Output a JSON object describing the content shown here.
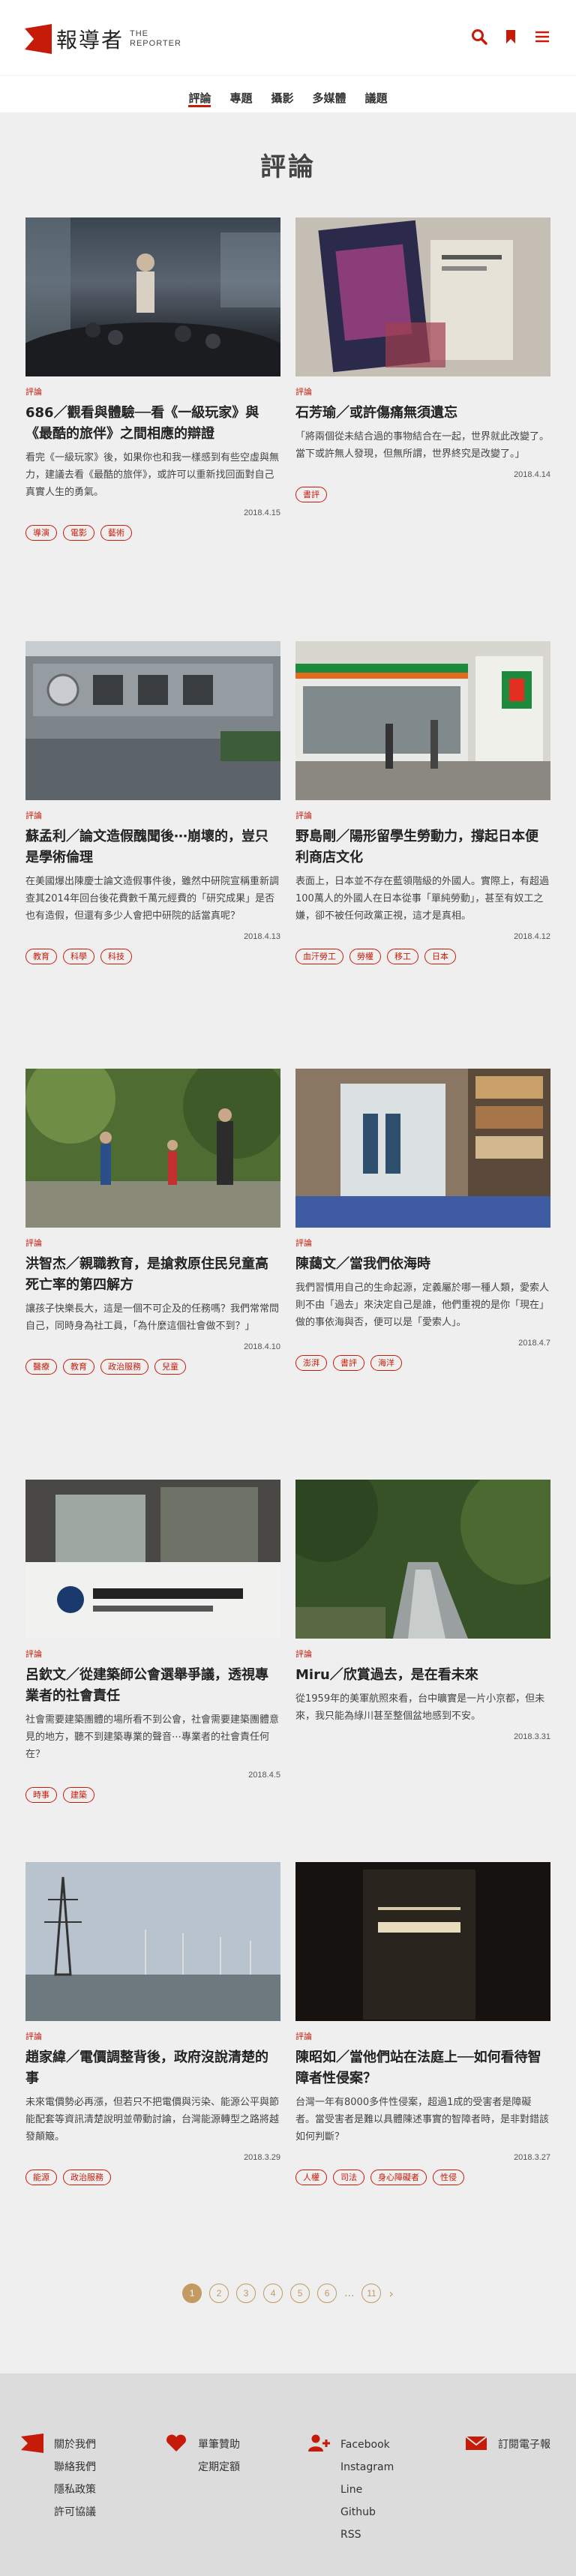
{
  "header": {
    "logo_zh": "報導者",
    "logo_en_1": "THE",
    "logo_en_2": "REPORTER"
  },
  "nav": {
    "items": [
      "評論",
      "專題",
      "攝影",
      "多媒體",
      "議題"
    ],
    "active": "評論"
  },
  "page_title": "評論",
  "cards": [
    {
      "tag": "評論",
      "title": "686／觀看與體驗──看《一級玩家》與《最酷的旅伴》之間相應的辯證",
      "excerpt": "看完《一級玩家》後，如果你也和我一樣感到有些空虛與無力，建議去看《最酷的旅伴》，或許可以重新找回面對自己真實人生的勇氣。",
      "date": "2018.4.15",
      "tags": [
        "導演",
        "電影",
        "藝術"
      ]
    },
    {
      "tag": "評論",
      "title": "石芳瑜／或許傷痛無須遺忘",
      "excerpt": "「將兩個從未結合過的事物結合在一起，世界就此改變了。當下或許無人發現，但無所謂，世界終究是改變了。」",
      "date": "2018.4.14",
      "tags": [
        "書評"
      ]
    },
    {
      "tag": "評論",
      "title": "蘇孟利／論文造假醜聞後⋯崩壞的，豈只是學術倫理",
      "excerpt": "在美國爆出陳慶士論文造假事件後，雖然中研院宣稱重新調查其2014年回台後花費數千萬元經費的「研究成果」是否也有造假，但還有多少人會把中研院的話當真呢？",
      "date": "2018.4.13",
      "tags": [
        "教育",
        "科學",
        "科技"
      ]
    },
    {
      "tag": "評論",
      "title": "野島剛／陽形留學生勞動力，撐起日本便利商店文化",
      "excerpt": "表面上，日本並不存在藍領階級的外國人。實際上，有超過100萬人的外國人在日本從事「單純勞動」，甚至有奴工之嫌，卻不被任何政黨正視，這才是真相。",
      "date": "2018.4.12",
      "tags": [
        "血汗勞工",
        "勞權",
        "移工",
        "日本"
      ]
    },
    {
      "tag": "評論",
      "title": "洪智杰／親職教育，是搶救原住民兒童高死亡率的第四解方",
      "excerpt": "讓孩子快樂長大，這是一個不可企及的任務嗎？我們常常問自己，同時身為社工員，「為什麼這個社會做不到？」",
      "date": "2018.4.10",
      "tags": [
        "醫療",
        "教育",
        "政治服務",
        "兒童"
      ]
    },
    {
      "tag": "評論",
      "title": "陳藹文／當我們依海時",
      "excerpt": "我們習慣用自己的生命起源，定義屬於哪一種人類，愛索人則不由「過去」來決定自己是誰，他們重視的是你「現在」做的事依海與否，便可以是「愛索人」。",
      "date": "2018.4.7",
      "tags": [
        "澎湃",
        "書評",
        "海洋"
      ]
    },
    {
      "tag": "評論",
      "title": "呂欽文／從建築師公會選舉爭議，透視專業者的社會責任",
      "excerpt": "社會需要建築團體的場所看不到公會，社會需要建築團體意見的地方，聽不到建築專業的聲音⋯專業者的社會責任何在？",
      "date": "2018.4.5",
      "tags": [
        "時事",
        "建築"
      ]
    },
    {
      "tag": "評論",
      "title": "Miru／欣賞過去，是在看未來",
      "excerpt": "從1959年的美軍航照來看，台中曠實是一片小京都，但未來，我只能為綠川甚至整個盆地感到不安。",
      "date": "2018.3.31",
      "tags": []
    },
    {
      "tag": "評論",
      "title": "趙家緯／電價調整背後，政府沒說清楚的事",
      "excerpt": "未來電價勢必再漲，但若只不把電價與污染、能源公平與節能配套等資訊清楚說明並帶動討論，台灣能源轉型之路將越發顛簸。",
      "date": "2018.3.29",
      "tags": [
        "能源",
        "政治服務"
      ]
    },
    {
      "tag": "評論",
      "title": "陳昭如／當他們站在法庭上──如何看待智障者性侵案？",
      "excerpt": "台灣一年有8000多件性侵案，超過1成的受害者是障礙者。當受害者是難以具體陳述事實的智障者時，是非對錯該如何判斷？",
      "date": "2018.3.27",
      "tags": [
        "人權",
        "司法",
        "身心障礙者",
        "性侵"
      ]
    }
  ],
  "pagination": {
    "pages": [
      "1",
      "2",
      "3",
      "4",
      "5",
      "6"
    ],
    "ellipsis": "...",
    "last": "11",
    "next": "›"
  },
  "footer": {
    "col1": [
      "關於我們",
      "聯絡我們",
      "隱私政策",
      "許可協議"
    ],
    "col2": [
      "單筆贊助",
      "定期定額"
    ],
    "col3": [
      "Facebook",
      "Instagram",
      "Line",
      "Github",
      "RSS"
    ],
    "col4": [
      "訂閱電子報"
    ]
  },
  "colors": {
    "accent": "#c71b0a",
    "pagination": "#c39a61"
  }
}
